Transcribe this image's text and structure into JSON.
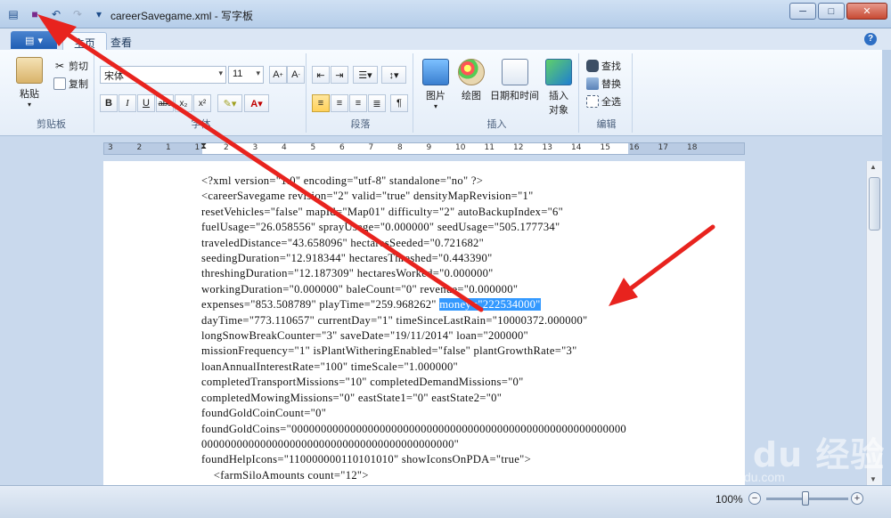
{
  "window": {
    "title": "careerSavegame.xml - 写字板"
  },
  "tabs": [
    {
      "label": "主页"
    },
    {
      "label": "查看"
    }
  ],
  "ribbon": {
    "clipboard": {
      "paste": "粘贴",
      "cut": "剪切",
      "copy": "复制",
      "group": "剪贴板"
    },
    "font": {
      "family": "宋体",
      "size": "11",
      "group": "字体"
    },
    "paragraph": {
      "group": "段落"
    },
    "insert": {
      "picture": "图片",
      "paint": "绘图",
      "datetime": "日期和时间",
      "object": "插入\n对象",
      "group": "插入"
    },
    "edit": {
      "find": "查找",
      "replace": "替换",
      "selectall": "全选",
      "group": "编辑"
    }
  },
  "ruler": {
    "ticks": [
      "3",
      "2",
      "1",
      "1",
      "2",
      "3",
      "4",
      "5",
      "6",
      "7",
      "8",
      "9",
      "10",
      "11",
      "12",
      "13",
      "14",
      "15",
      "16",
      "17",
      "18"
    ]
  },
  "document": {
    "lines": [
      "<?xml version=\"1.0\" encoding=\"utf-8\" standalone=\"no\" ?>",
      "<careerSavegame revision=\"2\" valid=\"true\" densityMapRevision=\"1\"",
      "resetVehicles=\"false\" mapId=\"Map01\" difficulty=\"2\" autoBackupIndex=\"6\"",
      "fuelUsage=\"26.058556\" sprayUsage=\"0.000000\" seedUsage=\"505.177734\"",
      "traveledDistance=\"43.658096\" hectaresSeeded=\"0.721682\"",
      "seedingDuration=\"12.918344\" hectaresThreshed=\"0.443390\"",
      "threshingDuration=\"12.187309\" hectaresWorked=\"0.000000\"",
      "workingDuration=\"0.000000\" baleCount=\"0\" revenue=\"0.000000\"",
      "expenses=\"853.508789\" playTime=\"259.968262\" ",
      "dayTime=\"773.110657\" currentDay=\"1\" timeSinceLastRain=\"10000372.000000\"",
      "longSnowBreakCounter=\"3\" saveDate=\"19/11/2014\" loan=\"200000\"",
      "missionFrequency=\"1\" isPlantWitheringEnabled=\"false\" plantGrowthRate=\"3\"",
      "loanAnnualInterestRate=\"100\" timeScale=\"1.000000\"",
      "completedTransportMissions=\"10\" completedDemandMissions=\"0\"",
      "completedMowingMissions=\"0\" eastState1=\"0\" eastState2=\"0\"",
      "foundGoldCoinCount=\"0\"",
      "foundGoldCoins=\"000000000000000000000000000000000000000000000000000000000",
      "0000000000000000000000000000000000000000000\"",
      "foundHelpIcons=\"110000000110101010\" showIconsOnPDA=\"true\">",
      "    <farmSiloAmounts count=\"12\">"
    ],
    "highlight": "money=\"222534000\""
  },
  "status": {
    "zoom": "100%"
  },
  "watermark": {
    "main": "Bai du 经验",
    "sub": "jingyan.baidu.com"
  }
}
